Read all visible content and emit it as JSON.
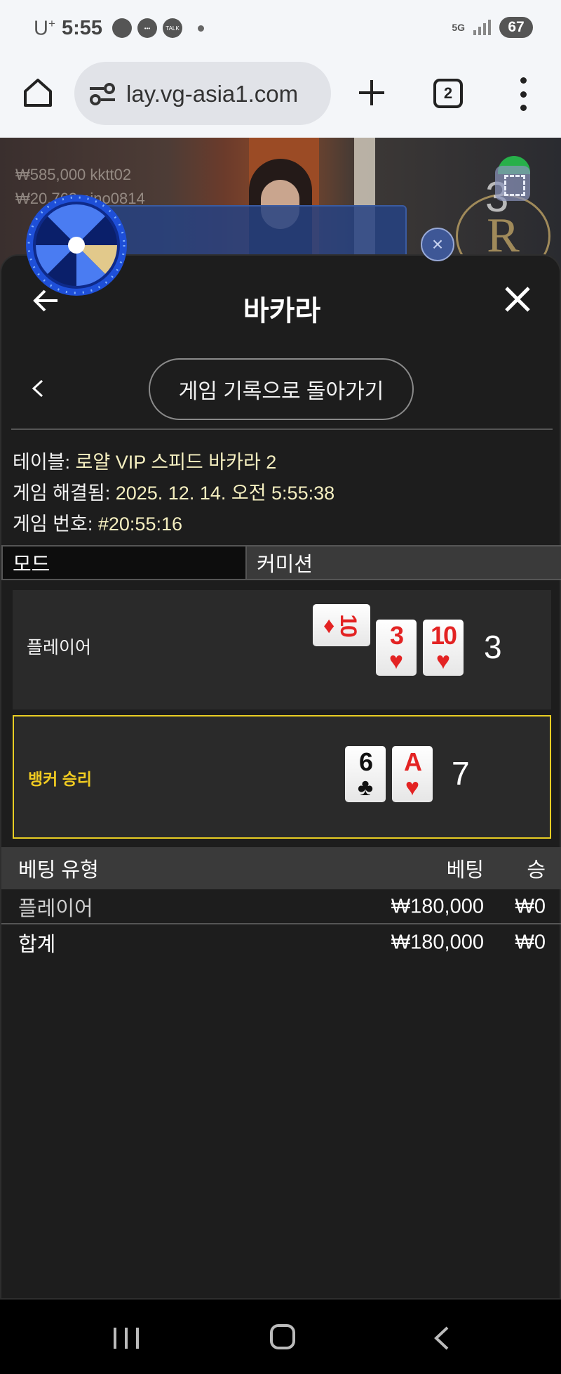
{
  "status_bar": {
    "carrier": "U",
    "carrier_sup": "+",
    "time": "5:55",
    "talk_label": "TALK",
    "network": "5G",
    "battery": "67"
  },
  "browser": {
    "url": "lay.vg-asia1.com",
    "tab_count": "2"
  },
  "video": {
    "ticker1": "₩585,000  kktt02",
    "ticker2": "₩20,763  pino0814",
    "crest_letter": "R",
    "overlay_number": "3"
  },
  "panel": {
    "title": "바카라",
    "return_button": "게임 기록으로 돌아가기",
    "info": [
      {
        "label": "테이블: ",
        "value": "로얄 VIP 스피드 바카라 2"
      },
      {
        "label": "게임 해결됨: ",
        "value": "2025. 12. 14. 오전 5:55:38"
      },
      {
        "label": "게임 번호: ",
        "value": "#20:55:16"
      }
    ],
    "column_mode": "모드",
    "column_commission": "커미션",
    "player": {
      "label": "플레이어",
      "score": "3",
      "cards": [
        {
          "rank": "10",
          "suit": "♦",
          "color": "#e32323",
          "sideways": true
        },
        {
          "rank": "3",
          "suit": "♥",
          "color": "#e32323"
        },
        {
          "rank": "10",
          "suit": "♥",
          "color": "#e32323"
        }
      ]
    },
    "banker": {
      "label": "뱅커 승리",
      "score": "7",
      "cards": [
        {
          "rank": "6",
          "suit": "♣",
          "color": "#111111"
        },
        {
          "rank": "A",
          "suit": "♥",
          "color": "#e32323"
        }
      ]
    },
    "bets": {
      "headers": [
        "베팅 유형",
        "베팅",
        "승"
      ],
      "rows": [
        {
          "type": "플레이어",
          "bet": "₩180,000",
          "win": "₩0"
        }
      ],
      "total": {
        "type": "합계",
        "bet": "₩180,000",
        "win": "₩0"
      }
    }
  },
  "colors": {
    "panel_bg": "#1d1d1d",
    "banker_highlight": "#e8cd23",
    "card_red": "#e32323"
  }
}
